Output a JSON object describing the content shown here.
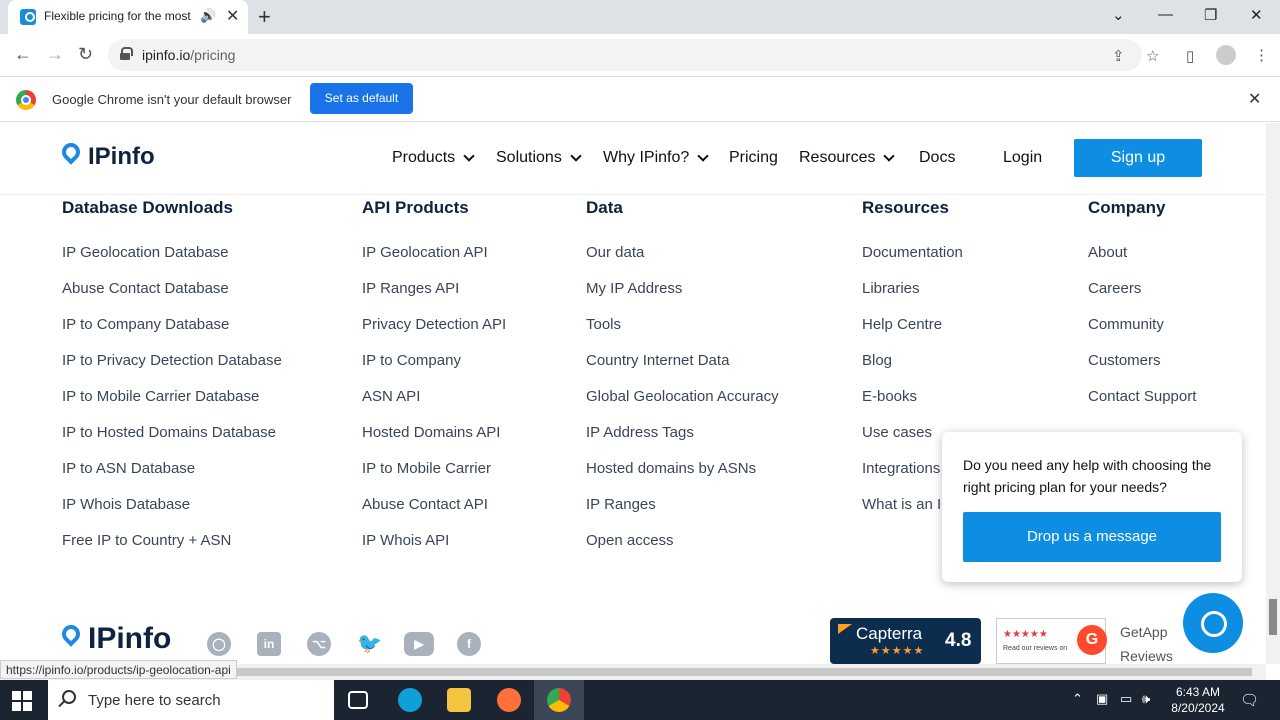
{
  "browser": {
    "tab_title": "Flexible pricing for the most",
    "url_host": "ipinfo.io",
    "url_path": "/pricing",
    "infobar_text": "Google Chrome isn't your default browser",
    "set_default_label": "Set as default"
  },
  "header": {
    "logo": "IPinfo",
    "nav": [
      {
        "label": "Products",
        "dropdown": true
      },
      {
        "label": "Solutions",
        "dropdown": true
      },
      {
        "label": "Why IPinfo?",
        "dropdown": true
      },
      {
        "label": "Pricing",
        "dropdown": false
      },
      {
        "label": "Resources",
        "dropdown": true
      },
      {
        "label": "Docs",
        "dropdown": false
      }
    ],
    "login": "Login",
    "signup": "Sign up"
  },
  "footer": {
    "columns": [
      {
        "title": "Database Downloads",
        "items": [
          "IP Geolocation Database",
          "Abuse Contact Database",
          "IP to Company Database",
          "IP to Privacy Detection Database",
          "IP to Mobile Carrier Database",
          "IP to Hosted Domains Database",
          "IP to ASN Database",
          "IP Whois Database",
          "Free IP to Country + ASN"
        ]
      },
      {
        "title": "API Products",
        "items": [
          "IP Geolocation API",
          "IP Ranges API",
          "Privacy Detection API",
          "IP to Company",
          "ASN API",
          "Hosted Domains API",
          "IP to Mobile Carrier",
          "Abuse Contact API",
          "IP Whois API"
        ]
      },
      {
        "title": "Data",
        "items": [
          "Our data",
          "My IP Address",
          "Tools",
          "Country Internet Data",
          "Global Geolocation Accuracy",
          "IP Address Tags",
          "Hosted domains by ASNs",
          "IP Ranges",
          "Open access"
        ]
      },
      {
        "title": "Resources",
        "items": [
          "Documentation",
          "Libraries",
          "Help Centre",
          "Blog",
          "E-books",
          "Use cases",
          "Integrations",
          "What is an I"
        ]
      },
      {
        "title": "Company",
        "items": [
          "About",
          "Careers",
          "Community",
          "Customers",
          "Contact Support"
        ]
      }
    ],
    "logo": "IPinfo",
    "capterra": {
      "name": "Capterra",
      "score": "4.8",
      "stars": "★★★★★"
    },
    "g2": {
      "stars": "★★★★★",
      "text": "Read our reviews on",
      "letter": "G"
    },
    "getapp": {
      "line1": "GetApp",
      "line2": "Reviews"
    }
  },
  "popup": {
    "text": "Do you need any help with choosing the right pricing plan for your needs?",
    "button": "Drop us a message"
  },
  "status_url": "https://ipinfo.io/products/ip-geolocation-api",
  "taskbar": {
    "search_placeholder": "Type here to search",
    "time": "6:43 AM",
    "date": "8/20/2024"
  },
  "colors": {
    "brand_blue": "#0d8ee3",
    "navy": "#0d2340",
    "taskbar": "#1b2431"
  }
}
